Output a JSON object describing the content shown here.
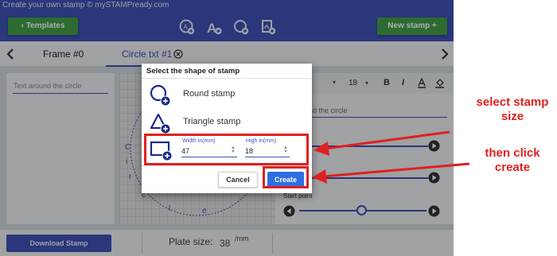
{
  "window": {
    "title": "Create your own stamp © mySTAMPready.com"
  },
  "toolbar": {
    "templates_label": "Templates",
    "new_stamp_label": "New stamp +",
    "icons": [
      "circle-text-icon",
      "add-text-icon",
      "add-circle-icon",
      "add-image-icon"
    ]
  },
  "tabs": [
    {
      "label": "Frame #0"
    },
    {
      "label": "Circle txt #1"
    }
  ],
  "left_panel": {
    "text_placeholder": "Text around the circle"
  },
  "right_panel": {
    "font_size": "18",
    "format_buttons": [
      "B",
      "I"
    ],
    "text_value": "nd the circle",
    "start_point_label": "Start point"
  },
  "canvas": {
    "visible_letters": [
      "C",
      "i",
      "r",
      "c",
      "l",
      "e"
    ]
  },
  "bottom": {
    "download_label": "Download Stamp",
    "plate_size_label": "Plate size:",
    "plate_size_value": "38",
    "plate_size_unit": "/mm"
  },
  "dialog": {
    "title": "Select the shape of stamp",
    "shapes": [
      {
        "label": "Round stamp"
      },
      {
        "label": "Triangle stamp"
      }
    ],
    "width_label": "Width in(mm)",
    "width_value": "47",
    "height_label": "High in(mm)",
    "height_value": "18",
    "cancel_label": "Cancel",
    "create_label": "Create"
  },
  "annotations": {
    "size_note": "select stamp size",
    "create_note": "then click create"
  },
  "colors": {
    "primary": "#3f51b5",
    "green": "#43a047",
    "annotation_red": "#e02020",
    "create_blue": "#2d6ee0"
  }
}
